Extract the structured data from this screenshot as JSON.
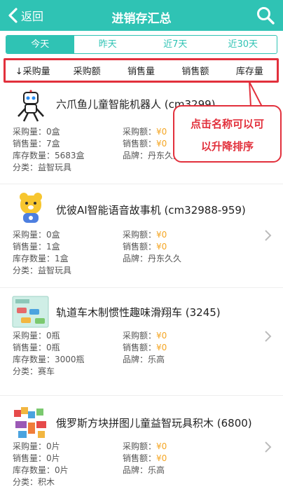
{
  "header": {
    "back_label": "返回",
    "title": "进销存汇总"
  },
  "tabs": [
    "今天",
    "昨天",
    "近7天",
    "近30天"
  ],
  "sort": [
    "↓采购量",
    "采购额",
    "销售量",
    "销售额",
    "库存量"
  ],
  "tooltip": {
    "line1": "点击名称可以可",
    "line2": "以升降排序"
  },
  "products": [
    {
      "name": "六爪鱼儿童智能机器人 (cm3299)",
      "purchase_qty": "采购量：0盒",
      "purchase_amt_label": "采购额：",
      "purchase_amt": "¥0",
      "sales_qty": "销售量：7盒",
      "sales_amt_label": "销售额：",
      "sales_amt": "¥0",
      "stock": "库存数量：5683盒",
      "brand": "品牌：丹东久久",
      "category": "分类：益智玩具",
      "icon": "robot-toy"
    },
    {
      "name": "优彼AI智能语音故事机 (cm32988-959)",
      "purchase_qty": "采购量：0盒",
      "purchase_amt_label": "采购额：",
      "purchase_amt": "¥0",
      "sales_qty": "销售量：1盒",
      "sales_amt_label": "销售额：",
      "sales_amt": "¥0",
      "stock": "库存数量：1盒",
      "brand": "品牌：丹东久久",
      "category": "分类：益智玩具",
      "icon": "bear-story-machine"
    },
    {
      "name": "轨道车木制惯性趣味滑翔车 (3245)",
      "purchase_qty": "采购量：0瓶",
      "purchase_amt_label": "采购额：",
      "purchase_amt": "¥0",
      "sales_qty": "销售量：0瓶",
      "sales_amt_label": "销售额：",
      "sales_amt": "¥0",
      "stock": "库存数量：3000瓶",
      "brand": "品牌：乐高",
      "category": "分类：赛车",
      "icon": "track-car-box"
    },
    {
      "name": "俄罗斯方块拼图儿童益智玩具积木 (6800)",
      "purchase_qty": "采购量：0片",
      "purchase_amt_label": "采购额：",
      "purchase_amt": "¥0",
      "sales_qty": "销售量：0片",
      "sales_amt_label": "销售额：",
      "sales_amt": "¥0",
      "stock": "库存数量：0片",
      "brand": "品牌：乐高",
      "category": "分类：积木",
      "icon": "blocks-toy"
    }
  ],
  "colors": {
    "accent": "#2fc3b4",
    "alert": "#e2303c",
    "money": "#f5a623"
  }
}
